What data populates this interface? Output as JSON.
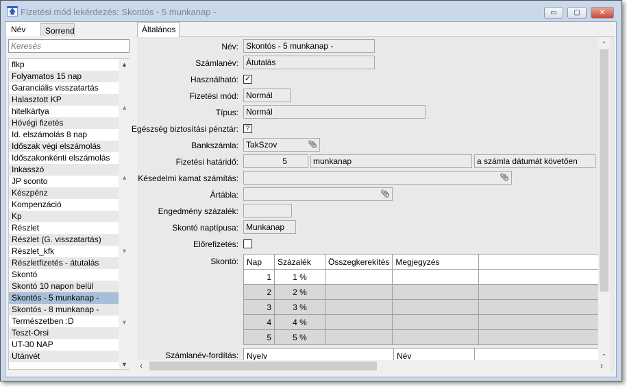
{
  "window": {
    "title": "Fizetési mód lekérdezés: Skontós - 5 munkanap -",
    "minimize": "▭",
    "maximize": "▢",
    "close": "✕"
  },
  "left": {
    "tabs": [
      "Név",
      "Sorrend"
    ],
    "search_placeholder": "Keresés",
    "items": [
      "flkp",
      "Folyamatos 15 nap",
      "Garanciális visszatartás",
      "Halasztott KP",
      "hitelkártya",
      "Hóvégi fizetés",
      "Id. elszámolás 8 nap",
      "Időszak végi elszámolás",
      "Időszakonkénti elszámolás",
      "Inkasszó",
      "JP sconto",
      "Készpénz",
      "Kompenzáció",
      "Kp",
      "Részlet",
      "Részlet (G. visszatartás)",
      "Részlet_kfk",
      "Részletfizetés - átutalás",
      "Skontó",
      "Skontó 10 napon belül",
      "Skontós - 5 munkanap -",
      "Skontós - 8 munkanap -",
      "Természetben :D",
      "Teszt-Orsi",
      "UT-30 NAP",
      "Utánvét"
    ],
    "selected_index": 20
  },
  "right": {
    "tab": "Általános",
    "fields": {
      "nev": {
        "label": "Név:",
        "value": "Skontós - 5 munkanap -"
      },
      "szamlanev": {
        "label": "Számlanév:",
        "value": "Átutalás"
      },
      "hasznalhato": {
        "label": "Használható:",
        "value": "✓"
      },
      "fizmod": {
        "label": "Fizetési mód:",
        "value": "Normál"
      },
      "tipus": {
        "label": "Típus:",
        "value": "Normál"
      },
      "egeszseg": {
        "label": "Egészség biztosítási pénztár:",
        "value": "?"
      },
      "bank": {
        "label": "Bankszámla:",
        "value": "TakSzov"
      },
      "hatarido": {
        "label": "Fizetési határidő:",
        "days": "5",
        "unit": "munkanap",
        "rule": "a számla dátumát követően"
      },
      "kesedelmi": {
        "label": "Késedelmi kamat számítás:",
        "value": ""
      },
      "artabla": {
        "label": "Ártábla:",
        "value": ""
      },
      "engedmeny": {
        "label": "Engedmény százalék:",
        "value": ""
      },
      "naptipus": {
        "label": "Skontó naptípusa:",
        "value": "Munkanap"
      },
      "elore": {
        "label": "Előrefizetés:",
        "value": ""
      }
    },
    "skonto": {
      "label": "Skontó:",
      "headers": [
        "Nap",
        "Százalék",
        "Összegkerekítés",
        "Megjegyzés"
      ],
      "rows": [
        [
          "1",
          "1 %",
          "",
          ""
        ],
        [
          "2",
          "2 %",
          "",
          ""
        ],
        [
          "3",
          "3 %",
          "",
          ""
        ],
        [
          "4",
          "4 %",
          "",
          ""
        ],
        [
          "5",
          "5 %",
          "",
          ""
        ]
      ]
    },
    "forditas": {
      "label": "Számlanév-fordítás:",
      "headers": [
        "Nyelv",
        "Név"
      ]
    }
  }
}
